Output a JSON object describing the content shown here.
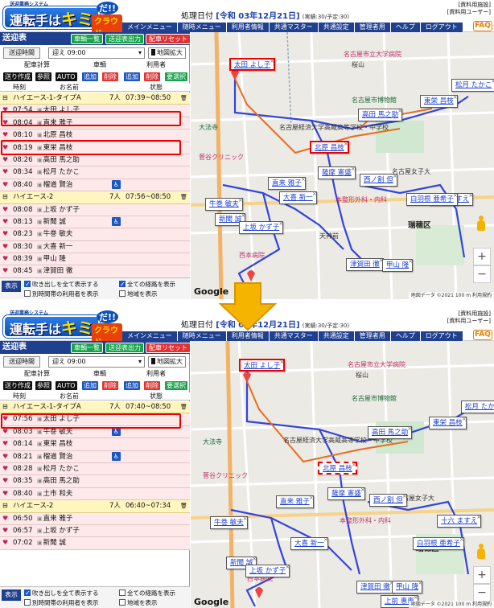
{
  "header": {
    "logo_sub": "送迎業務システム",
    "logo_main_pre": "運転手は",
    "logo_main_kimi": "キミ",
    "logo_dawa": "だ!!",
    "logo_cloud": "クラウド",
    "date_label": "処理日付",
    "faq": "FAQ",
    "facility": "[資料用施設]",
    "user": "[資料用ユーザー]",
    "menu": [
      "メインメニュー",
      "随時メニュー",
      "利用者情報",
      "共通マスター",
      "共通設定",
      "管理者用",
      "ヘルプ",
      "ログアウト"
    ]
  },
  "panel": {
    "title": "送迎表",
    "btn_vehicle_list": "車輌一覧",
    "btn_output": "送迎表出力",
    "btn_reset": "配車リセット",
    "time_label": "送迎時間",
    "time_value": "迎え 09:00",
    "map_zoom": "地図拡大",
    "calc_label": "配車計算",
    "vehicle_label": "車輌",
    "user_label": "利用者",
    "ops": [
      "送り作成",
      "参照",
      "AUTO",
      "追加",
      "削除",
      "追加",
      "削除",
      "要選択"
    ],
    "col_time": "時刻",
    "col_name": "お名前",
    "col_status": "状態",
    "display_btn": "表示",
    "chk_bubbles": "吹き出しを全て表示する",
    "chk_all_routes": "全ての経路を表示",
    "chk_separate": "別時間帯の利用者を表示",
    "chk_area": "地域を表示"
  },
  "screens": [
    {
      "date_value": "[令和 03年12月21日]",
      "counts": "(実績:30/予定:30)",
      "rows": [
        {
          "type": "group",
          "name": "ハイエース-1-タイプA",
          "count": "7人",
          "range": "07:39~08:50"
        },
        {
          "type": "item",
          "time": "07:54",
          "name": "太田 よし子",
          "wc": ""
        },
        {
          "type": "item",
          "time": "08:04",
          "name": "直来 雅子",
          "wc": ""
        },
        {
          "type": "item",
          "time": "08:10",
          "name": "北原 昌枝",
          "wc": ""
        },
        {
          "type": "item",
          "time": "08:19",
          "name": "東栄 昌枝",
          "wc": ""
        },
        {
          "type": "item",
          "time": "08:26",
          "name": "高田 馬之助",
          "wc": ""
        },
        {
          "type": "item",
          "time": "08:34",
          "name": "松月 たかこ",
          "wc": ""
        },
        {
          "type": "item",
          "time": "08:40",
          "name": "榴道 賢治",
          "wc": "♿"
        },
        {
          "type": "group",
          "name": "ハイエース-2",
          "count": "7人",
          "range": "07:56~08:50"
        },
        {
          "type": "item",
          "time": "08:08",
          "name": "上坂 かず子",
          "wc": ""
        },
        {
          "type": "item",
          "time": "08:13",
          "name": "新聞 誠",
          "wc": "♿"
        },
        {
          "type": "item",
          "time": "08:23",
          "name": "牛巻 敏夫",
          "wc": ""
        },
        {
          "type": "item",
          "time": "08:30",
          "name": "大喜 新一",
          "wc": ""
        },
        {
          "type": "item",
          "time": "08:39",
          "name": "甲山 隆",
          "wc": ""
        },
        {
          "type": "item",
          "time": "08:45",
          "name": "津賀田 徹",
          "wc": ""
        }
      ],
      "bubbles": [
        "太田 よし子",
        "松月 たかこ",
        "東栄 昌枝",
        "高田 馬之助",
        "北原 昌枝",
        "薩摩 憲盛",
        "直来 雅子",
        "西ノ割 但",
        "牛巻 敏夫",
        "十六 ますえ",
        "大喜 新一",
        "白羽根 亜希子",
        "新聞 誠",
        "上坂 かず子",
        "津賀田 徹",
        "甲山 隆"
      ]
    },
    {
      "date_value": "[令和 03年12月21日]",
      "counts": "(実績:30/予定:30)",
      "rows": [
        {
          "type": "group",
          "name": "ハイエース-1-タイプA",
          "count": "7人",
          "range": "07:40~08:50"
        },
        {
          "type": "item",
          "time": "07:56",
          "name": "太田 よし子",
          "wc": ""
        },
        {
          "type": "item",
          "time": "08:03",
          "name": "牛巻 敏夫",
          "wc": "♿"
        },
        {
          "type": "item",
          "time": "08:14",
          "name": "東栄 昌枝",
          "wc": ""
        },
        {
          "type": "item",
          "time": "08:21",
          "name": "榴道 賢治",
          "wc": "♿"
        },
        {
          "type": "item",
          "time": "08:28",
          "name": "松月 たかこ",
          "wc": ""
        },
        {
          "type": "item",
          "time": "08:35",
          "name": "高田 馬之助",
          "wc": ""
        },
        {
          "type": "item",
          "time": "08:40",
          "name": "土市 和夫",
          "wc": ""
        },
        {
          "type": "group",
          "name": "ハイエース-2",
          "count": "7人",
          "range": "06:40~07:34"
        },
        {
          "type": "item",
          "time": "06:50",
          "name": "直来 雅子",
          "wc": ""
        },
        {
          "type": "item",
          "time": "06:57",
          "name": "上坂 かず子",
          "wc": ""
        },
        {
          "type": "item",
          "time": "07:02",
          "name": "新聞 誠",
          "wc": ""
        }
      ],
      "bubbles": [
        "太田 よし子",
        "松月 たか",
        "東栄 昌枝",
        "高田 馬之助",
        "北原 昌枝",
        "薩摩 憲盛",
        "直来 雅子",
        "西ノ割 但",
        "牛巻 敏夫",
        "十六 ますえ",
        "大喜 新一",
        "白羽根 亜希子",
        "新聞 誠",
        "上坂 かず子",
        "津賀田 徹",
        "甲山 隆",
        "上前 惠惠"
      ]
    }
  ],
  "map_labels": {
    "hospital": "名古屋市立大学病院",
    "museum": "名古屋市博物館",
    "university": "名古屋経済大学高蔵高等学校・中学校",
    "sakurayama": "桜山",
    "mizuho_park": "瑞穂公園",
    "mizuho_ward": "瑞穂区",
    "daiho": "大法寺",
    "tenjinmae": "天神前",
    "kogakko": "名古屋女子大",
    "nishimoto": "西本病院",
    "suga": "菅谷クリニック",
    "orthopedics": "本整形外科・内科",
    "hashimoto": "はし本",
    "google": "Google",
    "copyright": "地図データ ©2021  100 m",
    "terms": "利用規約"
  },
  "colors": {
    "brand_blue": "#1f3f8f",
    "accent_green": "#17a34a",
    "accent_red": "#e33030",
    "highlight_red": "#e00000",
    "route_blue": "#3344dd",
    "route_orange": "#ea6b1e"
  },
  "icons": {
    "arrow": "down-arrow-icon",
    "wheelchair": "wheelchair-icon",
    "pegman": "pegman-icon"
  }
}
